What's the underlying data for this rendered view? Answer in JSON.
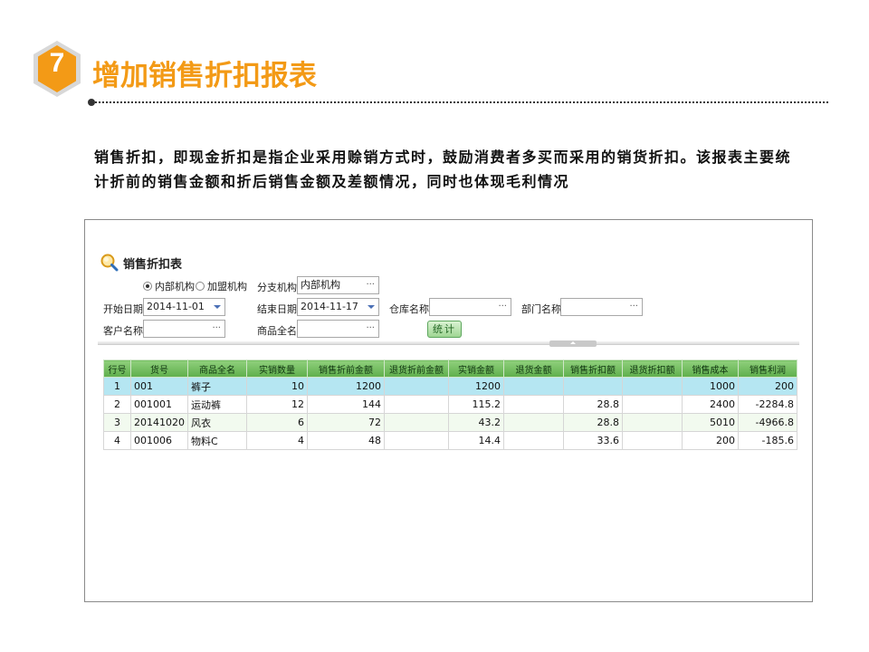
{
  "slide": {
    "badge": "7",
    "title": "增加销售折扣报表",
    "description": "销售折扣，即现金折扣是指企业采用赊销方式时，鼓励消费者多买而采用的销货折扣。该报表主要统计折前的销售金额和折后销售金额及差额情况，同时也体现毛利情况",
    "accent": "#f39a16"
  },
  "app": {
    "title": "销售折扣表",
    "radio_internal": "内部机构",
    "radio_franchise": "加盟机构",
    "branch_label": "分支机构",
    "branch_value": "内部机构",
    "start_date_label": "开始日期",
    "start_date_value": "2014-11-01",
    "end_date_label": "结束日期",
    "end_date_value": "2014-11-17",
    "warehouse_label": "仓库名称",
    "dept_label": "部门名称",
    "customer_label": "客户名称",
    "product_label": "商品全名",
    "ellipsis": "···",
    "stat_button": "统计"
  },
  "table": {
    "columns": [
      "行号",
      "货号",
      "商品全名",
      "实销数量",
      "销售折前金额",
      "退货折前金额",
      "实销金额",
      "退货金额",
      "销售折扣额",
      "退货折扣额",
      "销售成本",
      "销售利润"
    ],
    "rows": [
      [
        "1",
        "001",
        "裤子",
        "10",
        "1200",
        "",
        "1200",
        "",
        "",
        "",
        "1000",
        "200"
      ],
      [
        "2",
        "001001",
        "运动裤",
        "12",
        "144",
        "",
        "115.2",
        "",
        "28.8",
        "",
        "2400",
        "-2284.8"
      ],
      [
        "3",
        "20141020",
        "风衣",
        "6",
        "72",
        "",
        "43.2",
        "",
        "28.8",
        "",
        "5010",
        "-4966.8"
      ],
      [
        "4",
        "001006",
        "物料C",
        "4",
        "48",
        "",
        "14.4",
        "",
        "33.6",
        "",
        "200",
        "-185.6"
      ]
    ]
  }
}
